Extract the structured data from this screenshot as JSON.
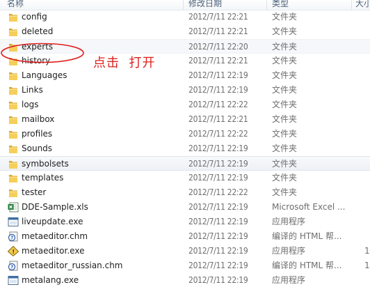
{
  "header": {
    "name": "名称",
    "date": "修改日期",
    "type": "类型",
    "size": "大小"
  },
  "annotation": "点击  打开",
  "rows": [
    {
      "name": "config",
      "date": "2012/7/11 22:21",
      "type": "文件夹",
      "size": "",
      "icon": "folder-icon"
    },
    {
      "name": "deleted",
      "date": "2012/7/11 22:21",
      "type": "文件夹",
      "size": "",
      "icon": "folder-icon"
    },
    {
      "name": "experts",
      "date": "2012/7/11 22:20",
      "type": "文件夹",
      "size": "",
      "icon": "folder-icon"
    },
    {
      "name": "history",
      "date": "2012/7/11 22:21",
      "type": "文件夹",
      "size": "",
      "icon": "folder-icon"
    },
    {
      "name": "Languages",
      "date": "2012/7/11 22:19",
      "type": "文件夹",
      "size": "",
      "icon": "folder-icon"
    },
    {
      "name": "Links",
      "date": "2012/7/11 22:19",
      "type": "文件夹",
      "size": "",
      "icon": "folder-icon"
    },
    {
      "name": "logs",
      "date": "2012/7/11 22:22",
      "type": "文件夹",
      "size": "",
      "icon": "folder-icon"
    },
    {
      "name": "mailbox",
      "date": "2012/7/11 22:21",
      "type": "文件夹",
      "size": "",
      "icon": "folder-icon"
    },
    {
      "name": "profiles",
      "date": "2012/7/11 22:22",
      "type": "文件夹",
      "size": "",
      "icon": "folder-icon"
    },
    {
      "name": "Sounds",
      "date": "2012/7/11 22:19",
      "type": "文件夹",
      "size": "",
      "icon": "folder-icon"
    },
    {
      "name": "symbolsets",
      "date": "2012/7/11 22:19",
      "type": "文件夹",
      "size": "",
      "icon": "folder-icon"
    },
    {
      "name": "templates",
      "date": "2012/7/11 22:19",
      "type": "文件夹",
      "size": "",
      "icon": "folder-icon"
    },
    {
      "name": "tester",
      "date": "2012/7/11 22:22",
      "type": "文件夹",
      "size": "",
      "icon": "folder-icon"
    },
    {
      "name": "DDE-Sample.xls",
      "date": "2012/7/11 22:19",
      "type": "Microsoft Excel ...",
      "size": "",
      "icon": "excel-icon"
    },
    {
      "name": "liveupdate.exe",
      "date": "2012/7/11 22:19",
      "type": "应用程序",
      "size": "",
      "icon": "exe-icon"
    },
    {
      "name": "metaeditor.chm",
      "date": "2012/7/11 22:19",
      "type": "编译的 HTML 帮...",
      "size": "",
      "icon": "chm-icon"
    },
    {
      "name": "metaeditor.exe",
      "date": "2012/7/11 22:19",
      "type": "应用程序",
      "size": "1",
      "icon": "metaeditor-icon"
    },
    {
      "name": "metaeditor_russian.chm",
      "date": "2012/7/11 22:19",
      "type": "编译的 HTML 帮...",
      "size": "1",
      "icon": "chm-icon"
    },
    {
      "name": "metalang.exe",
      "date": "2012/7/11 22:19",
      "type": "应用程序",
      "size": "",
      "icon": "exe-icon"
    }
  ],
  "state": {
    "selected_row": "symbolsets",
    "hovered_row": "experts"
  },
  "colors": {
    "annotation": "#e0201e",
    "header_text": "#4c607a",
    "folder": "#f2c54b",
    "meta_text": "#6d6d6d"
  }
}
